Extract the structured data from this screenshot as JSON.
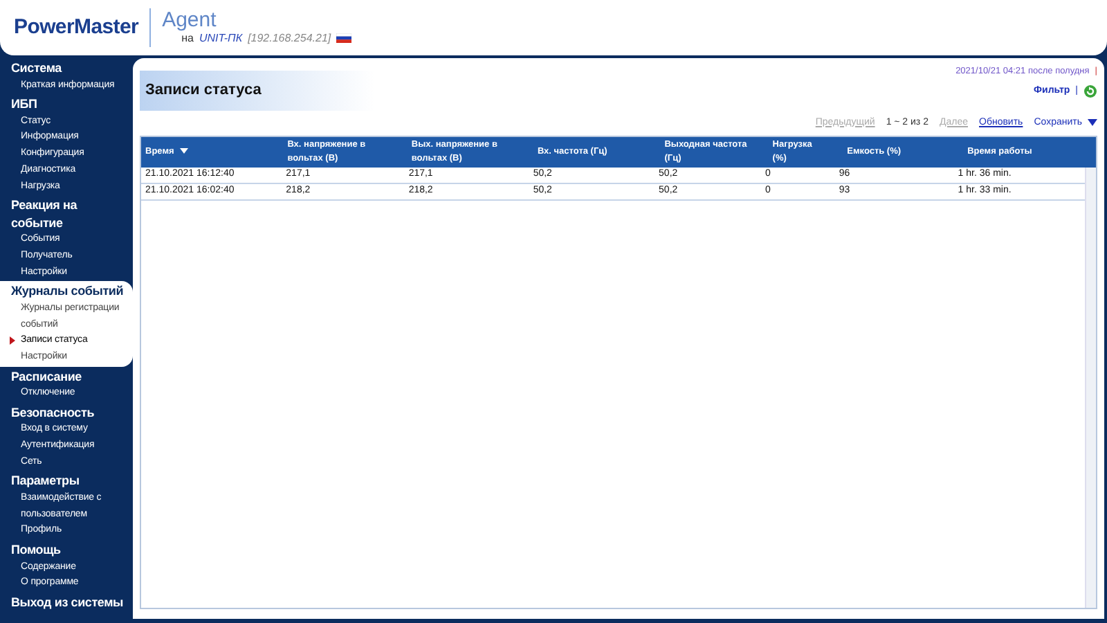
{
  "header": {
    "logo": "PowerMaster",
    "product": "Agent",
    "on_label": "на",
    "host": "UNIT-ПК",
    "address": "[192.168.254.21]"
  },
  "sidebar": {
    "groups": [
      {
        "title": "Система",
        "selected": false,
        "items": [
          {
            "label": "Краткая информация",
            "selected": false
          }
        ]
      },
      {
        "title": "ИБП",
        "selected": false,
        "items": [
          {
            "label": "Статус",
            "selected": false
          },
          {
            "label": "Информация",
            "selected": false
          },
          {
            "label": "Конфигурация",
            "selected": false
          },
          {
            "label": "Диагностика",
            "selected": false
          },
          {
            "label": "Нагрузка",
            "selected": false
          }
        ]
      },
      {
        "title": "Реакция на событие",
        "selected": false,
        "items": [
          {
            "label": "События",
            "selected": false
          },
          {
            "label": "Получатель",
            "selected": false
          },
          {
            "label": "Настройки",
            "selected": false
          }
        ]
      },
      {
        "title": "Журналы событий",
        "selected": true,
        "items": [
          {
            "label": "Журналы регистрации событий",
            "selected": false
          },
          {
            "label": "Записи статуса",
            "selected": true
          },
          {
            "label": "Настройки",
            "selected": false
          }
        ]
      },
      {
        "title": "Расписание",
        "selected": false,
        "items": [
          {
            "label": "Отключение",
            "selected": false
          }
        ]
      },
      {
        "title": "Безопасность",
        "selected": false,
        "items": [
          {
            "label": "Вход в систему",
            "selected": false
          },
          {
            "label": "Аутентификация",
            "selected": false
          },
          {
            "label": "Сеть",
            "selected": false
          }
        ]
      },
      {
        "title": "Параметры",
        "selected": false,
        "items": [
          {
            "label": "Взаимодействие с пользователем",
            "selected": false
          },
          {
            "label": "Профиль",
            "selected": false
          }
        ]
      },
      {
        "title": "Помощь",
        "selected": false,
        "items": [
          {
            "label": "Содержание",
            "selected": false
          },
          {
            "label": "О программе",
            "selected": false
          }
        ]
      },
      {
        "title": "Выход из системы",
        "selected": false
      }
    ]
  },
  "page": {
    "title": "Записи статуса",
    "timestamp": "2021/10/21 04:21 после полудня",
    "timestamp_separator": "|",
    "filter": "Фильтр",
    "filter_separator": "|",
    "pager": [
      {
        "label": "Предыдущий",
        "kind": "link",
        "disabled": true
      },
      {
        "label": "1 ~ 2 из 2",
        "kind": "text"
      },
      {
        "label": "Далее",
        "kind": "link",
        "disabled": true
      },
      {
        "label": "Обновить",
        "kind": "link",
        "disabled": false
      },
      {
        "label": "Сохранить",
        "kind": "menu",
        "disabled": false
      }
    ]
  },
  "table": {
    "columns": [
      {
        "label": "Время",
        "sorted": true
      },
      {
        "label": "Вх. напряжение в вольтах (В)",
        "sorted": false
      },
      {
        "label": "Вых. напряжение в вольтах (В)",
        "sorted": false
      },
      {
        "label": "Вх. частота (Гц)",
        "sorted": false
      },
      {
        "label": "Выходная частота (Гц)",
        "sorted": false
      },
      {
        "label": "Нагрузка (%)",
        "sorted": false
      },
      {
        "label": "Емкость (%)",
        "sorted": false
      },
      {
        "label": "Время работы",
        "sorted": false
      }
    ],
    "rows": [
      [
        "21.10.2021 16:12:40",
        "217,1",
        "217,1",
        "50,2",
        "50,2",
        "0",
        "96",
        "1 hr. 36 min."
      ],
      [
        "21.10.2021 16:02:40",
        "218,2",
        "218,2",
        "50,2",
        "50,2",
        "0",
        "93",
        "1 hr. 33 min."
      ]
    ]
  }
}
